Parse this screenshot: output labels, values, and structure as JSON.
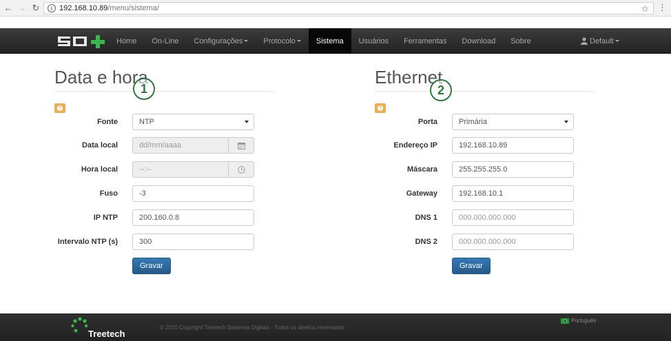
{
  "browser": {
    "url_host": "192.168.10.89",
    "url_path": "/menu/sistema/"
  },
  "navbar": {
    "items": [
      {
        "label": "Home"
      },
      {
        "label": "On-Line"
      },
      {
        "label": "Configurações",
        "dropdown": true
      },
      {
        "label": "Protocolo",
        "dropdown": true
      },
      {
        "label": "Sistema",
        "active": true
      },
      {
        "label": "Usuários"
      },
      {
        "label": "Ferramentas"
      },
      {
        "label": "Download"
      },
      {
        "label": "Sobre"
      }
    ],
    "user_label": "Default"
  },
  "datetime_panel": {
    "title": "Data e hora",
    "badge": "1",
    "fields": {
      "fonte": {
        "label": "Fonte",
        "value": "NTP"
      },
      "data_local": {
        "label": "Data local",
        "value": "dd/mm/aaaa"
      },
      "hora_local": {
        "label": "Hora local",
        "value": "--:--"
      },
      "fuso": {
        "label": "Fuso",
        "value": "-3"
      },
      "ip_ntp": {
        "label": "IP NTP",
        "value": "200.160.0.8"
      },
      "intervalo_ntp": {
        "label": "Intervalo NTP (s)",
        "value": "300"
      }
    },
    "save_label": "Gravar"
  },
  "ethernet_panel": {
    "title": "Ethernet",
    "badge": "2",
    "fields": {
      "porta": {
        "label": "Porta",
        "value": "Primária"
      },
      "endereco_ip": {
        "label": "Endereço IP",
        "value": "192.168.10.89"
      },
      "mascara": {
        "label": "Máscara",
        "value": "255.255.255.0"
      },
      "gateway": {
        "label": "Gateway",
        "value": "192.168.10.1"
      },
      "dns1": {
        "label": "DNS 1",
        "placeholder": "000.000.000.000"
      },
      "dns2": {
        "label": "DNS 2",
        "placeholder": "000.000.000.000"
      }
    },
    "save_label": "Gravar"
  },
  "footer": {
    "brand": "Treetech",
    "copyright": "© 2015 Copyright Treetech Sistemas Digitais - Todos os direitos reservados",
    "language": "Português"
  },
  "colors": {
    "navbar_bg": "#222222",
    "primary_button": "#337ab7",
    "help_button": "#f0ad4e",
    "badge_green": "#2a7a3c",
    "logo_green": "#3cb54a"
  }
}
